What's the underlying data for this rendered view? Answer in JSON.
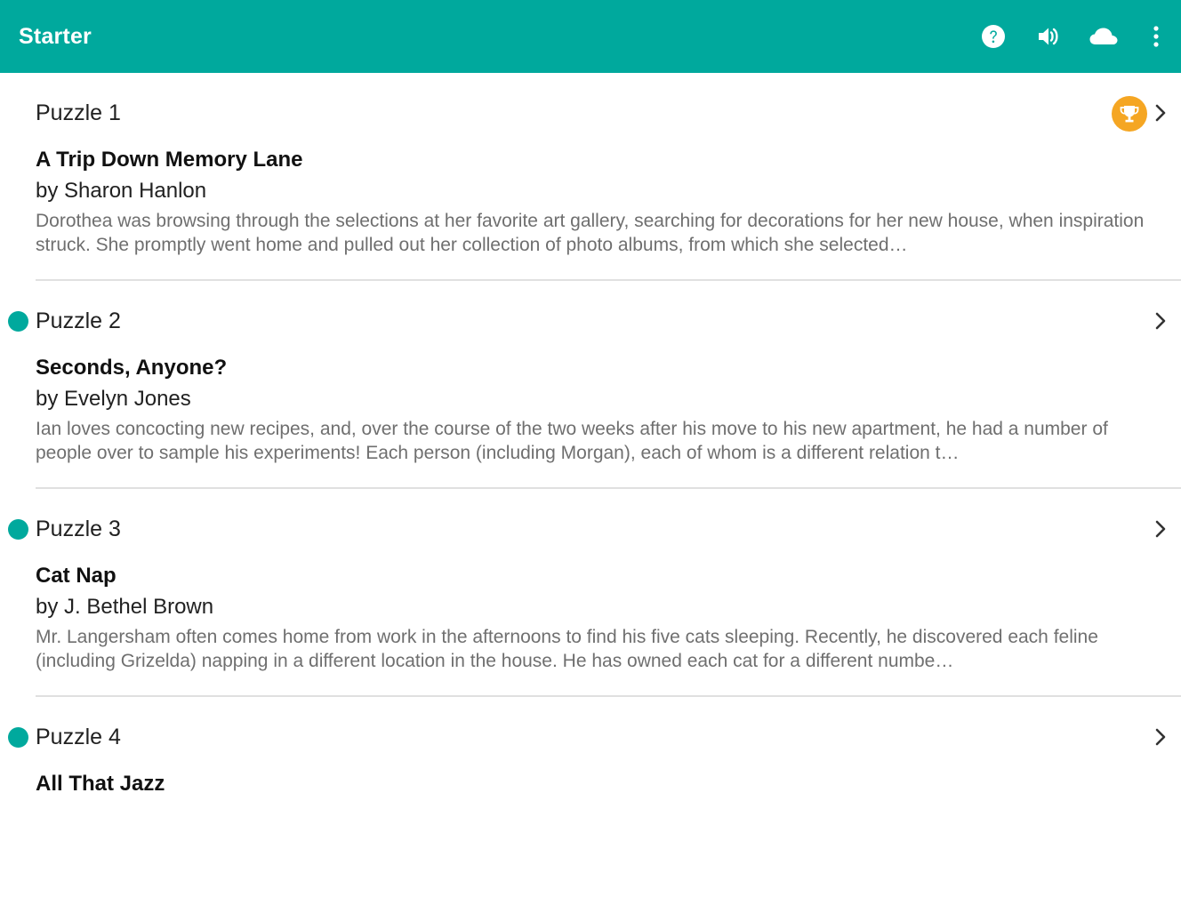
{
  "appbar": {
    "title": "Starter",
    "actions": [
      "help-icon",
      "volume-icon",
      "cloud-icon",
      "more-vert-icon"
    ]
  },
  "colors": {
    "primary": "#00a99d",
    "trophy": "#f5a623",
    "description_text": "#6f6f6f"
  },
  "puzzles": [
    {
      "number": "Puzzle 1",
      "title": "A Trip Down Memory Lane",
      "author": "by Sharon Hanlon",
      "description": "Dorothea was browsing through the selections at her favorite art gallery, searching for decorations for her new house, when inspiration struck. She promptly went home and pulled out her collection of photo albums, from which she selected…",
      "status": "solved"
    },
    {
      "number": "Puzzle 2",
      "title": "Seconds, Anyone?",
      "author": "by Evelyn Jones",
      "description": "Ian loves concocting new recipes, and, over the course of the two weeks after his move to his new apartment, he had a number of people over to sample his experiments! Each person (including Morgan), each of whom is a different relation t…",
      "status": "new"
    },
    {
      "number": "Puzzle 3",
      "title": "Cat Nap",
      "author": "by J. Bethel Brown",
      "description": "Mr. Langersham often comes home from work in the afternoons to find his five cats sleeping. Recently, he discovered each feline (including Grizelda) napping in a different location in the house. He has owned each cat for a different numbe…",
      "status": "new"
    },
    {
      "number": "Puzzle 4",
      "title": "All That Jazz",
      "author": "",
      "description": "",
      "status": "new"
    }
  ]
}
